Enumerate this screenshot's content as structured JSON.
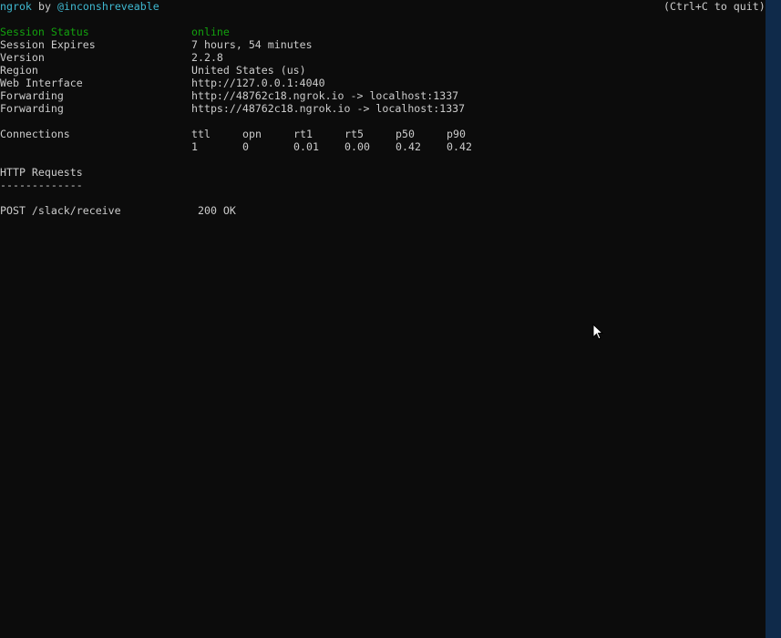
{
  "header": {
    "app_name": "ngrok",
    "by_text": " by ",
    "author": "@inconshreveable",
    "quit_hint": "(Ctrl+C to quit)"
  },
  "session": {
    "status": {
      "label": "Session Status",
      "value": "online"
    },
    "expires": {
      "label": "Session Expires",
      "value": "7 hours, 54 minutes"
    },
    "version": {
      "label": "Version",
      "value": "2.2.8"
    },
    "region": {
      "label": "Region",
      "value": "United States (us)"
    },
    "web_interface": {
      "label": "Web Interface",
      "value": "http://127.0.0.1:4040"
    },
    "forwarding_http": {
      "label": "Forwarding",
      "value": "http://48762c18.ngrok.io -> localhost:1337"
    },
    "forwarding_https": {
      "label": "Forwarding",
      "value": "https://48762c18.ngrok.io -> localhost:1337"
    }
  },
  "connections": {
    "label": "Connections",
    "headers": [
      "ttl",
      "opn",
      "rt1",
      "rt5",
      "p50",
      "p90"
    ],
    "values": [
      "1",
      "0",
      "0.01",
      "0.00",
      "0.42",
      "0.42"
    ]
  },
  "http_requests": {
    "title": "HTTP Requests",
    "divider": "-------------",
    "rows": [
      {
        "request": "POST /slack/receive",
        "status": "200 OK"
      }
    ]
  },
  "colors": {
    "background": "#0c0c0c",
    "text": "#cccccc",
    "cyan": "#3fb8d0",
    "green": "#13a10e",
    "scrollbar": "#0f2a4a"
  }
}
